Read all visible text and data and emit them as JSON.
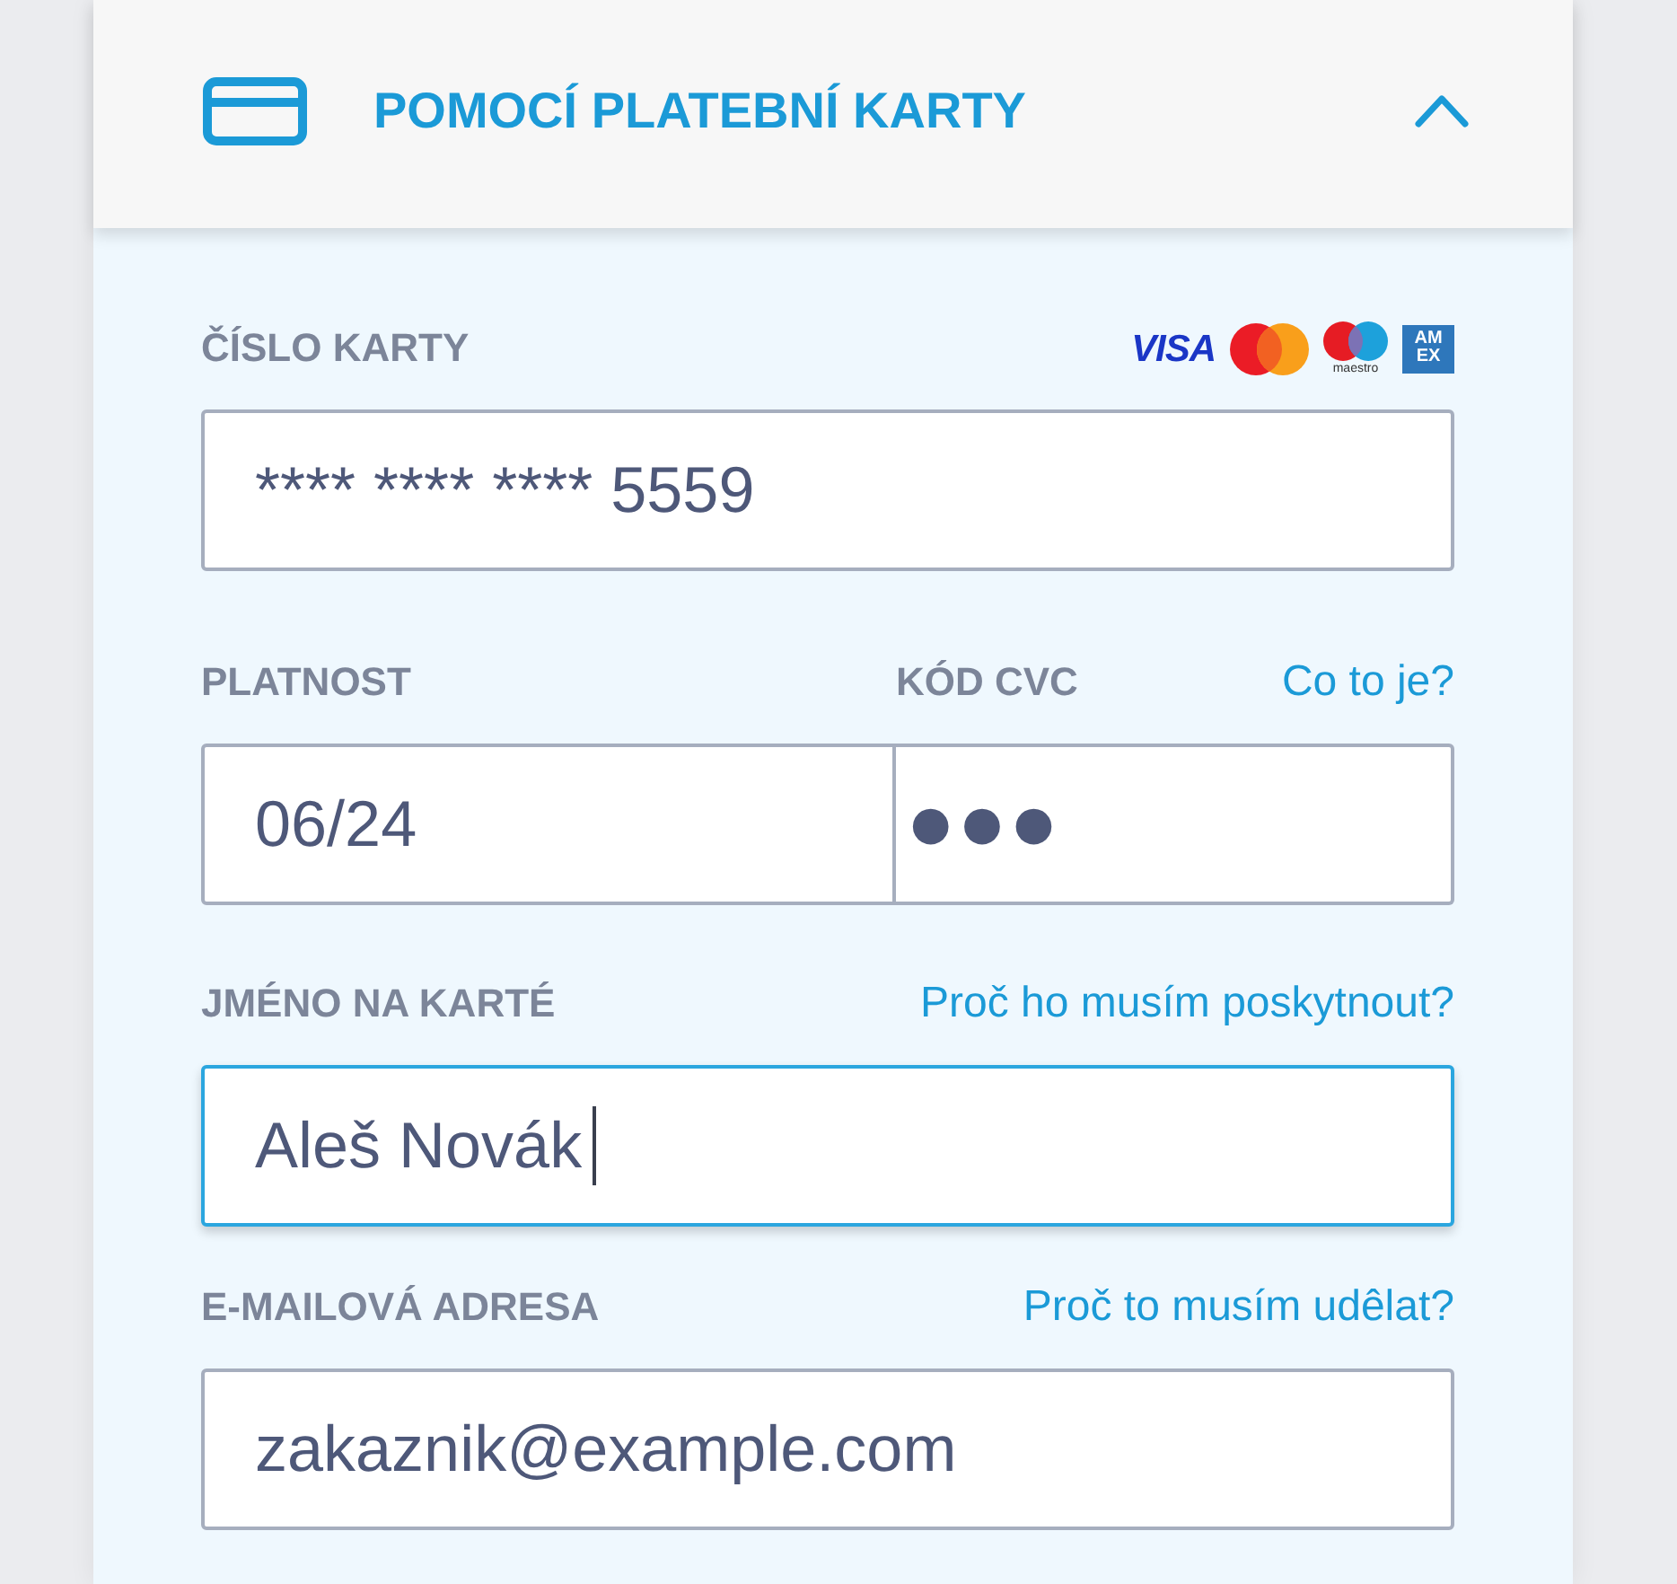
{
  "header": {
    "title": "POMOCÍ PLATEBNÍ KARTY",
    "expanded": true
  },
  "rows": [
    {
      "fields": [
        {
          "label": "ČÍSLO KARTY",
          "kind": "text",
          "value": "**** **** **** 5559",
          "focused": false
        }
      ],
      "brands": [
        {
          "kind": "visa",
          "text": "VISA"
        },
        {
          "kind": "mastercard"
        },
        {
          "kind": "maestro",
          "text": "maestro"
        },
        {
          "kind": "amex",
          "lines": [
            "AM",
            "EX"
          ]
        }
      ]
    },
    {
      "fields": [
        {
          "label": "PLATNOST",
          "kind": "text",
          "value": "06/24",
          "focused": false
        },
        {
          "label": "KÓD CVC",
          "kind": "masked",
          "value": "●●●",
          "focused": false,
          "link": "Co to je?"
        }
      ]
    },
    {
      "fields": [
        {
          "label": "JMÉNO NA KARTÉ",
          "kind": "text",
          "value": "Aleš Novák",
          "focused": true,
          "link": "Proč ho musím poskytnout?"
        }
      ]
    },
    {
      "fields": [
        {
          "label": "E-MAILOVÁ ADRESA",
          "kind": "text",
          "value": "zakaznik@example.com",
          "focused": false,
          "link": "Proč to musím udêlat?"
        }
      ]
    }
  ]
}
